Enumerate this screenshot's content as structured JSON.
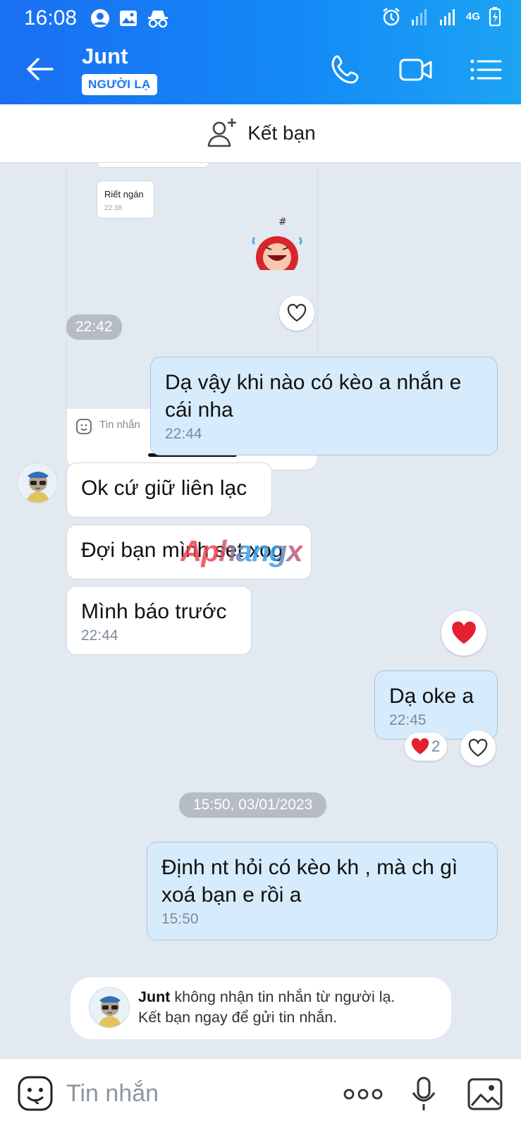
{
  "status_bar": {
    "time": "16:08",
    "network": "4G"
  },
  "header": {
    "contact_name": "Junt",
    "badge": "NGƯỜI LẠ"
  },
  "friend_bar": {
    "label": "Kết bạn"
  },
  "shared_screenshot": {
    "bubble_text": "Riết ngán",
    "bubble_time": "22:38",
    "input_placeholder": "Tin nhắn"
  },
  "messages": [
    {
      "type": "time_pill",
      "text": "22:42"
    },
    {
      "type": "out",
      "text": "Dạ vậy khi nào có kèo a nhắn e cái nha",
      "time": "22:44"
    },
    {
      "type": "in",
      "text": "Ok cứ giữ liên lạc"
    },
    {
      "type": "in",
      "text": "Đợi bạn mình set xog"
    },
    {
      "type": "in",
      "text": "Mình báo trước",
      "time": "22:44"
    },
    {
      "type": "out",
      "text": "Dạ oke a",
      "time": "22:45",
      "reaction_count": "2"
    },
    {
      "type": "date_pill",
      "text": "15:50, 03/01/2023"
    },
    {
      "type": "out",
      "text": "Định nt hỏi có kèo kh , mà ch gì xoá bạn e rồi a",
      "time": "15:50"
    }
  ],
  "watermark": "Aphangx",
  "notice": {
    "name": "Junt",
    "line1_rest": " không nhận tin nhắn từ người lạ.",
    "line2": "Kết bạn ngay để gửi tin nhắn."
  },
  "input": {
    "placeholder": "Tin nhắn"
  },
  "colors": {
    "header_start": "#1a6ff2",
    "header_end": "#1ca4f4",
    "chat_background": "#e2e9f1",
    "outgoing_bubble": "#d6ebfb",
    "incoming_bubble": "#ffffff",
    "heart": "#e5202e"
  }
}
